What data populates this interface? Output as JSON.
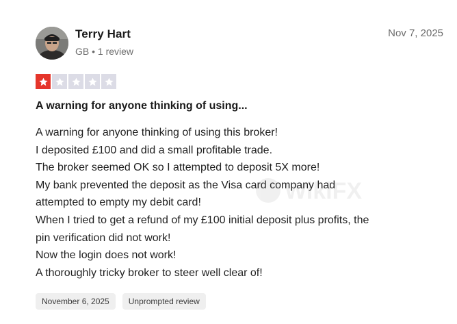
{
  "review": {
    "author": {
      "name": "Terry Hart",
      "meta": "GB • 1 review",
      "avatar_icon": "user-photo-avatar"
    },
    "date": "Nov 7, 2025",
    "rating": {
      "value": 1,
      "max": 5,
      "filled_color": "#e5352b",
      "empty_color": "#dcdce6"
    },
    "title": "A warning for anyone thinking of using...",
    "body_lines": [
      "A warning for anyone thinking of using this broker!",
      "I deposited £100 and did a small profitable trade.",
      "The broker seemed OK so I attempted to deposit 5X more!",
      "My bank prevented the deposit as the Visa card company had",
      "attempted to empty my debit card!",
      "When I tried to get a refund of my £100 initial deposit plus profits, the",
      "pin verification did not work!",
      "Now the login does not work!",
      "A thoroughly tricky broker to steer well clear of!"
    ],
    "tags": {
      "experience_date": "November 6, 2025",
      "review_type": "Unprompted review"
    },
    "watermark": "WikiFX"
  }
}
